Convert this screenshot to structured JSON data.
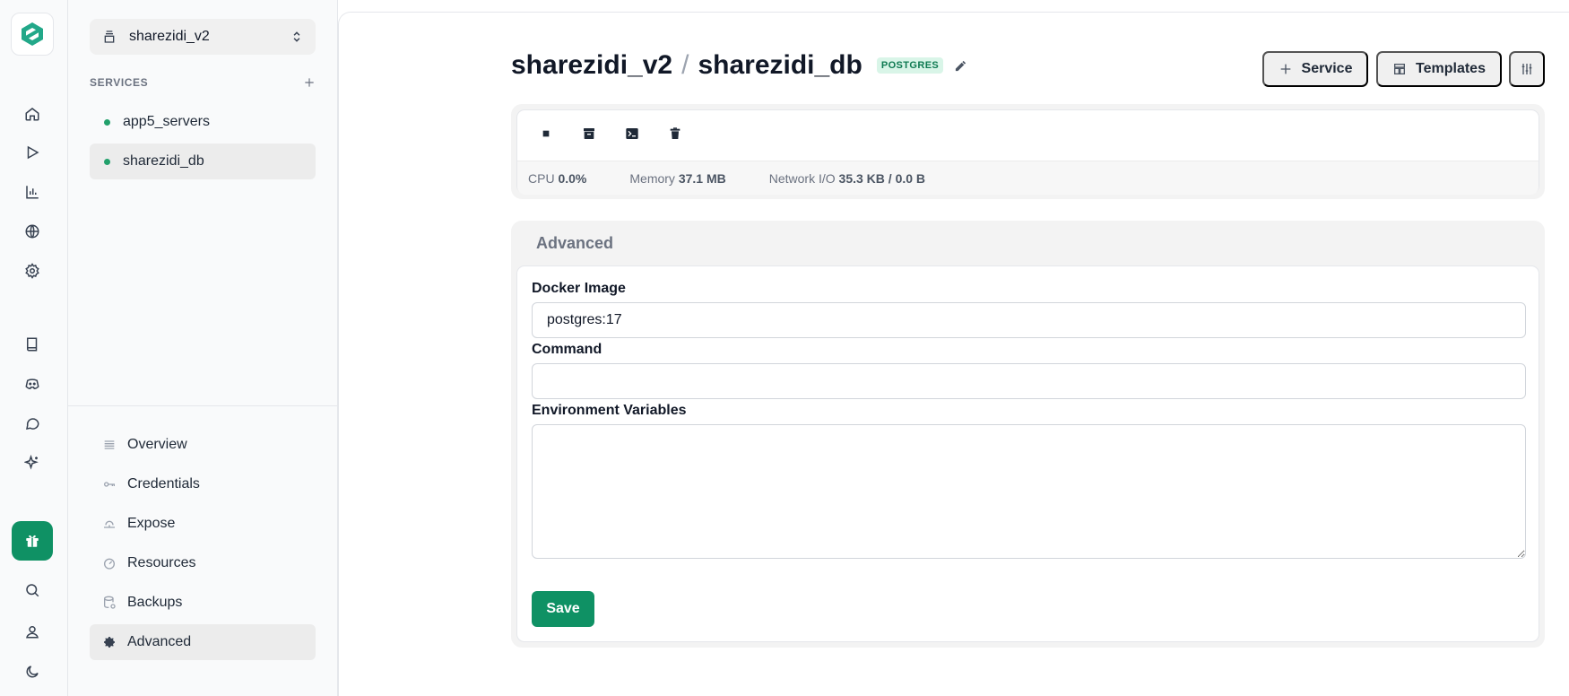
{
  "rail": {
    "items": [
      {
        "name": "home"
      },
      {
        "name": "deployments"
      },
      {
        "name": "analytics"
      },
      {
        "name": "domains"
      },
      {
        "name": "settings"
      },
      {
        "name": "docs"
      },
      {
        "name": "discord"
      },
      {
        "name": "feedback"
      },
      {
        "name": "whats-new"
      },
      {
        "name": "gift"
      },
      {
        "name": "search"
      },
      {
        "name": "account"
      },
      {
        "name": "theme"
      }
    ],
    "active": "gift"
  },
  "sidebar": {
    "project": "sharezidi_v2",
    "services_heading": "SERVICES",
    "services": [
      {
        "label": "app5_servers",
        "selected": false
      },
      {
        "label": "sharezidi_db",
        "selected": true
      }
    ],
    "nav": [
      {
        "label": "Overview",
        "icon": "list-icon"
      },
      {
        "label": "Credentials",
        "icon": "key-icon"
      },
      {
        "label": "Expose",
        "icon": "expose-icon"
      },
      {
        "label": "Resources",
        "icon": "gauge-icon"
      },
      {
        "label": "Backups",
        "icon": "database-restore-icon"
      },
      {
        "label": "Advanced",
        "icon": "gear-icon",
        "selected": true
      }
    ]
  },
  "header": {
    "project": "sharezidi_v2",
    "separator": "/",
    "service": "sharezidi_db",
    "badge": "POSTGRES",
    "buttons": {
      "service": "Service",
      "templates": "Templates"
    }
  },
  "stats": {
    "cpu_label": "CPU",
    "cpu_value": "0.0%",
    "memory_label": "Memory",
    "memory_value": "37.1 MB",
    "network_label": "Network I/O",
    "network_value": "35.3 KB / 0.0 B"
  },
  "advanced": {
    "title": "Advanced",
    "docker_image_label": "Docker Image",
    "docker_image_value": "postgres:17",
    "command_label": "Command",
    "command_value": "",
    "env_label": "Environment Variables",
    "env_value": "",
    "save_label": "Save"
  },
  "colors": {
    "accent": "#0f9164",
    "badge_bg": "#d9f5e8",
    "status_dot": "#22a06b"
  }
}
